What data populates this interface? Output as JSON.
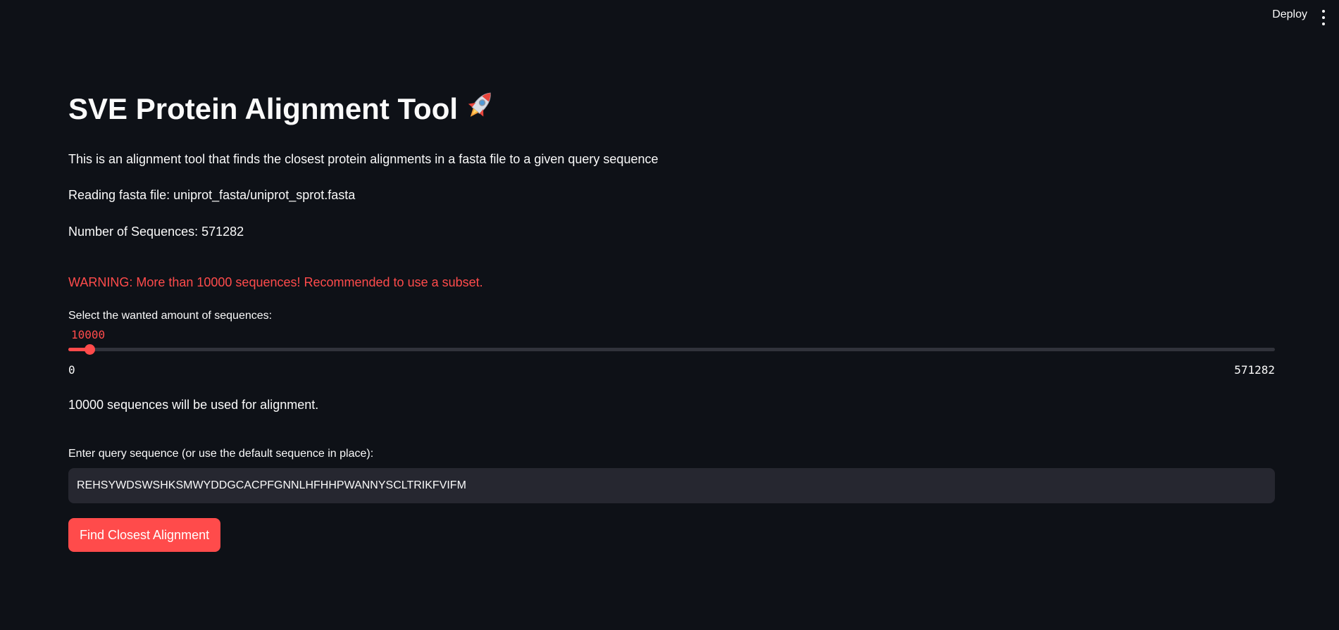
{
  "header": {
    "deploy_label": "Deploy",
    "menu_icon": "vertical-ellipsis-icon"
  },
  "main": {
    "title": "SVE Protein Alignment Tool",
    "title_icon": "rocket-icon",
    "description": "This is an alignment tool that finds the closest protein alignments in a fasta file to a given query sequence",
    "reading_file": "Reading fasta file: uniprot_fasta/uniprot_sprot.fasta",
    "num_sequences": "Number of Sequences: 571282",
    "warning": "WARNING: More than 10000 sequences! Recommended to use a subset.",
    "slider": {
      "label": "Select the wanted amount of sequences:",
      "value": "10000",
      "min": "0",
      "max": "571282",
      "fraction": 0.0175
    },
    "sequences_used": "10000 sequences will be used for alignment.",
    "query": {
      "label": "Enter query sequence (or use the default sequence in place):",
      "value": "REHSYWDSWSHKSMWYDDGCACPFGNNLHFHHPWANNYSCLTRIKFVIFM"
    },
    "find_button_label": "Find Closest Alignment"
  },
  "colors": {
    "background": "#0e1117",
    "accent": "#ff4b4b",
    "input_bg": "#262730",
    "track": "#31333b"
  }
}
